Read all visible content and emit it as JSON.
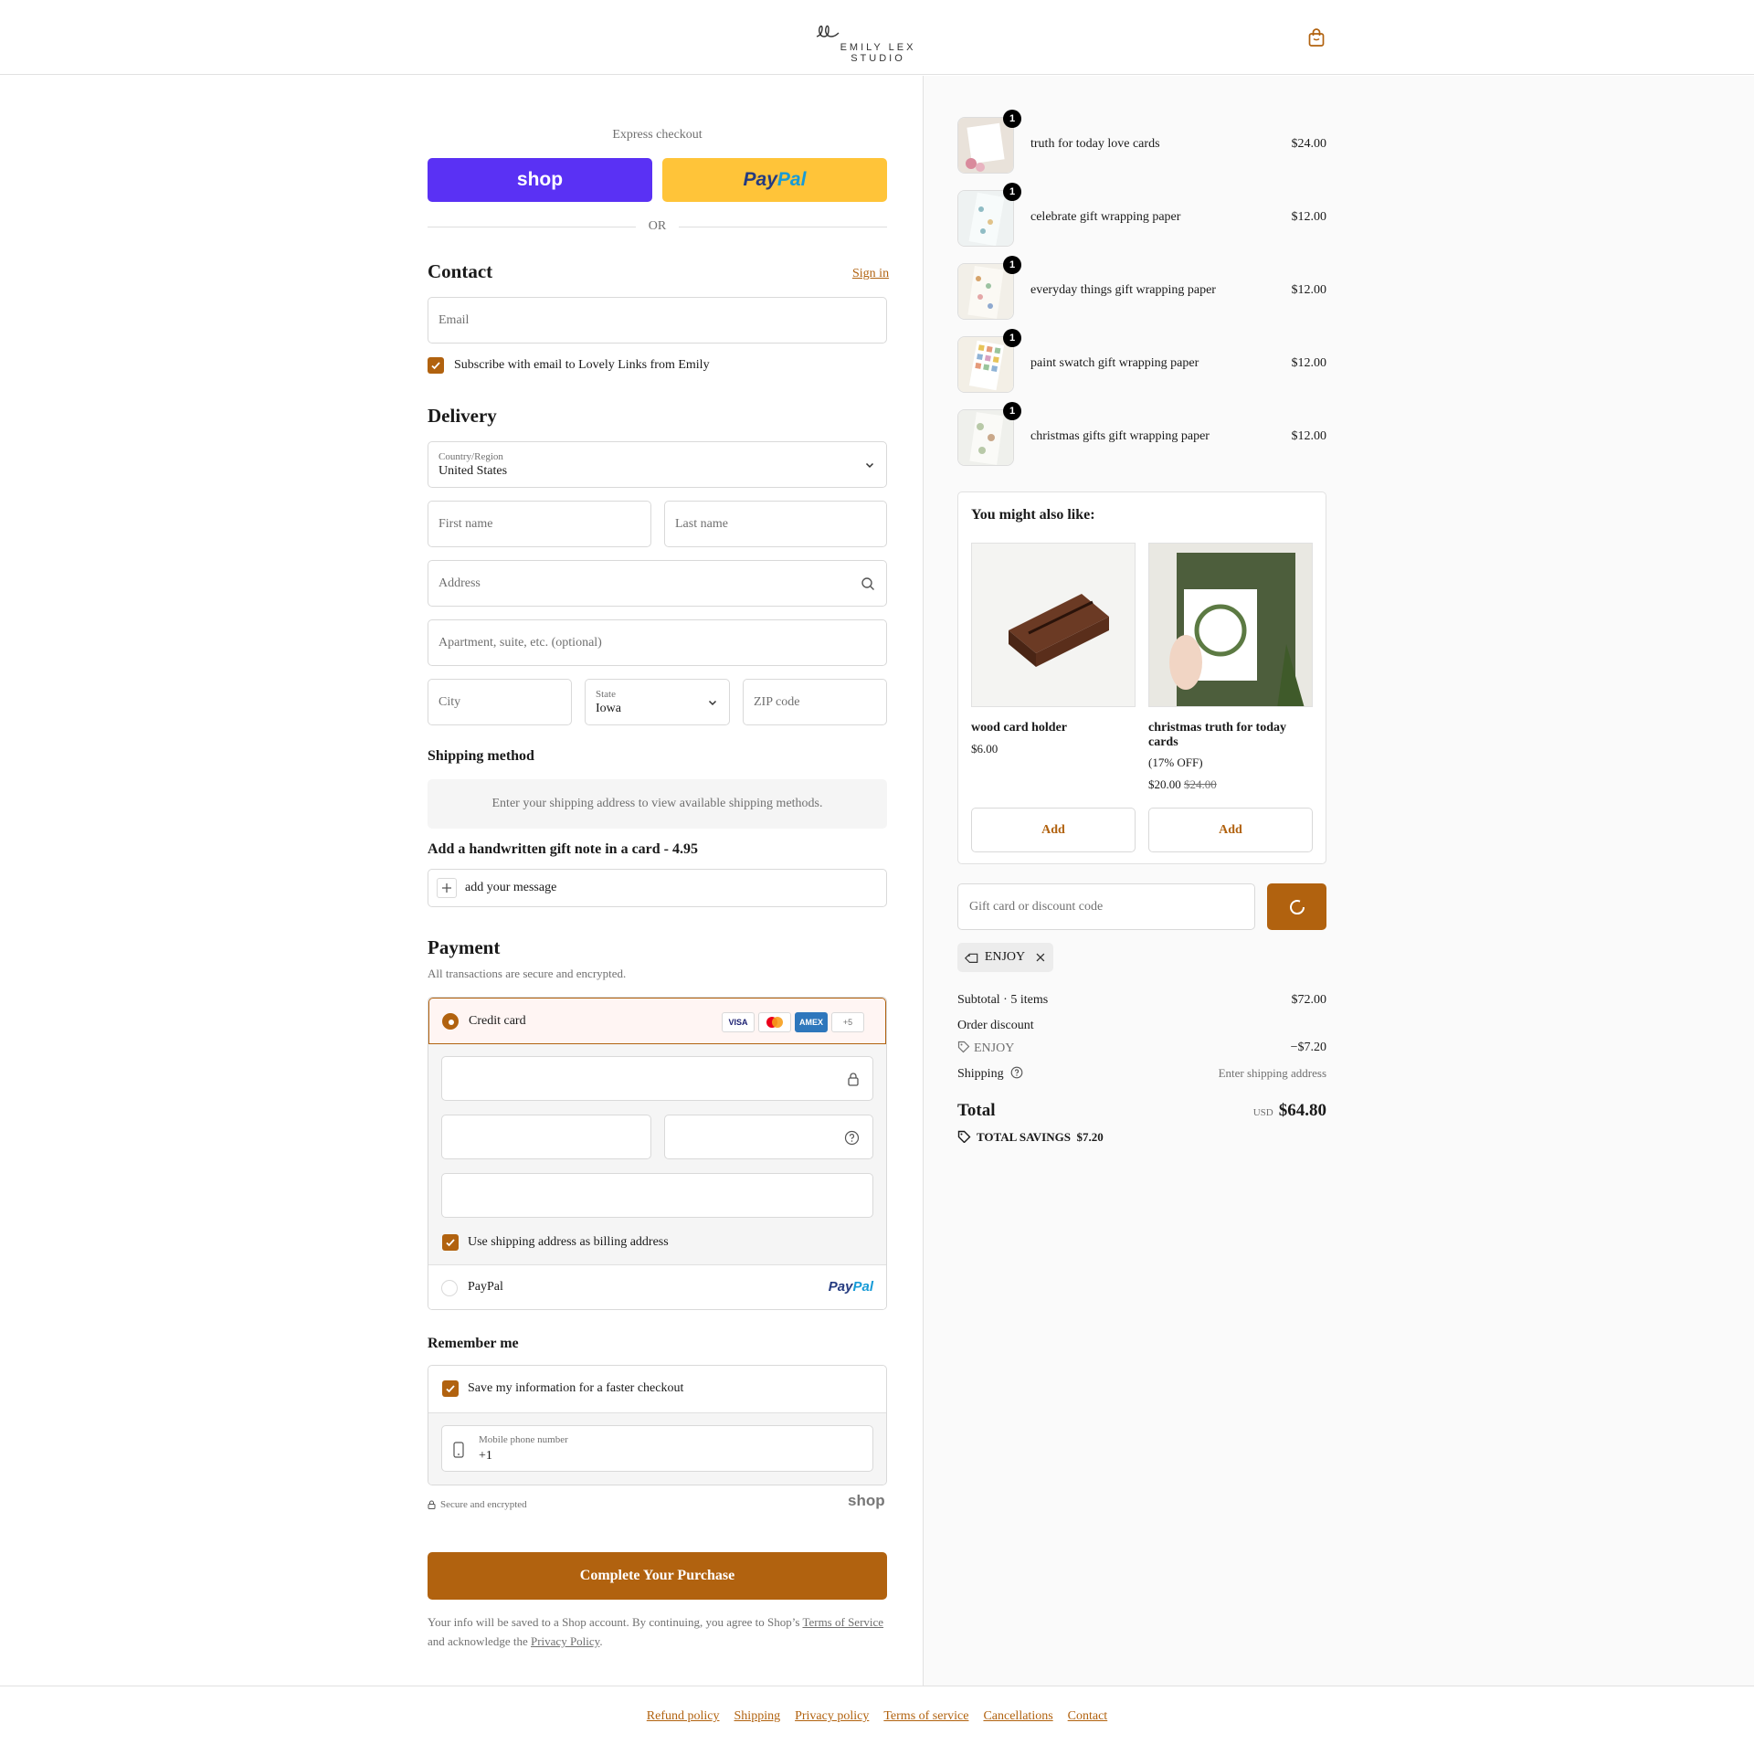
{
  "header": {
    "brand": "EMILY LEX STUDIO"
  },
  "express": {
    "label": "Express checkout",
    "shop_label": "shop",
    "paypal_a": "Pay",
    "paypal_b": "Pal",
    "or": "OR"
  },
  "contact": {
    "title": "Contact",
    "sign_in": "Sign in",
    "email_placeholder": "Email",
    "subscribe": "Subscribe with email to Lovely Links from Emily"
  },
  "delivery": {
    "title": "Delivery",
    "country_label": "Country/Region",
    "country_value": "United States",
    "first_name": "First name",
    "last_name": "Last name",
    "address": "Address",
    "apartment": "Apartment, suite, etc. (optional)",
    "city": "City",
    "state_label": "State",
    "state_value": "Iowa",
    "zip": "ZIP code"
  },
  "shipping_method": {
    "title": "Shipping method",
    "message": "Enter your shipping address to view available shipping methods."
  },
  "gift_note": {
    "title": "Add a handwritten gift note in a card - 4.95",
    "placeholder": "add your message"
  },
  "payment": {
    "title": "Payment",
    "subtitle": "All transactions are secure and encrypted.",
    "credit_card": "Credit card",
    "cards": [
      "VISA",
      "",
      "AMEX",
      "+5"
    ],
    "billing_same": "Use shipping address as billing address",
    "paypal": "PayPal",
    "paypal_logo_a": "Pay",
    "paypal_logo_b": "Pal"
  },
  "remember": {
    "title": "Remember me",
    "save": "Save my information for a faster checkout",
    "phone_label": "Mobile phone number",
    "phone_value": "+1"
  },
  "secure": {
    "text": "Secure and encrypted",
    "shop": "shop"
  },
  "complete_button": "Complete Your Purchase",
  "terms": {
    "pre": "Your info will be saved to a Shop account. By continuing, you agree to Shop’s ",
    "tos": "Terms of Service",
    "mid": " and acknowledge the ",
    "privacy": "Privacy Policy",
    "post": "."
  },
  "cart": [
    {
      "name": "truth for today love cards",
      "price": "$24.00",
      "qty": "1"
    },
    {
      "name": "celebrate gift wrapping paper",
      "price": "$12.00",
      "qty": "1"
    },
    {
      "name": "everyday things gift wrapping paper",
      "price": "$12.00",
      "qty": "1"
    },
    {
      "name": "paint swatch gift wrapping paper",
      "price": "$12.00",
      "qty": "1"
    },
    {
      "name": "christmas gifts gift wrapping paper",
      "price": "$12.00",
      "qty": "1"
    }
  ],
  "upsell": {
    "title": "You might also like:",
    "products": [
      {
        "name": "wood card holder",
        "price": "$6.00",
        "discount": "",
        "old_price": "",
        "add": "Add"
      },
      {
        "name": "christmas truth for today cards",
        "discount": "(17% OFF)",
        "price": "$20.00",
        "old_price": "$24.00",
        "add": "Add"
      }
    ]
  },
  "discount": {
    "placeholder": "Gift card or discount code",
    "applied_code": "ENJOY"
  },
  "summary": {
    "subtotal_label": "Subtotal · 5 items",
    "subtotal": "$72.00",
    "order_discount": "Order discount",
    "code": "ENJOY",
    "discount_value": "−$7.20",
    "shipping_label": "Shipping",
    "shipping_value": "Enter shipping address",
    "total_label": "Total",
    "currency": "USD",
    "total": "$64.80",
    "savings_label": "TOTAL SAVINGS",
    "savings": "$7.20"
  },
  "footer": [
    "Refund policy",
    "Shipping",
    "Privacy policy",
    "Terms of service",
    "Cancellations",
    "Contact"
  ],
  "colors": {
    "accent": "#b1620f",
    "shop_purple": "#5a31f4",
    "paypal_yellow": "#ffc439"
  }
}
